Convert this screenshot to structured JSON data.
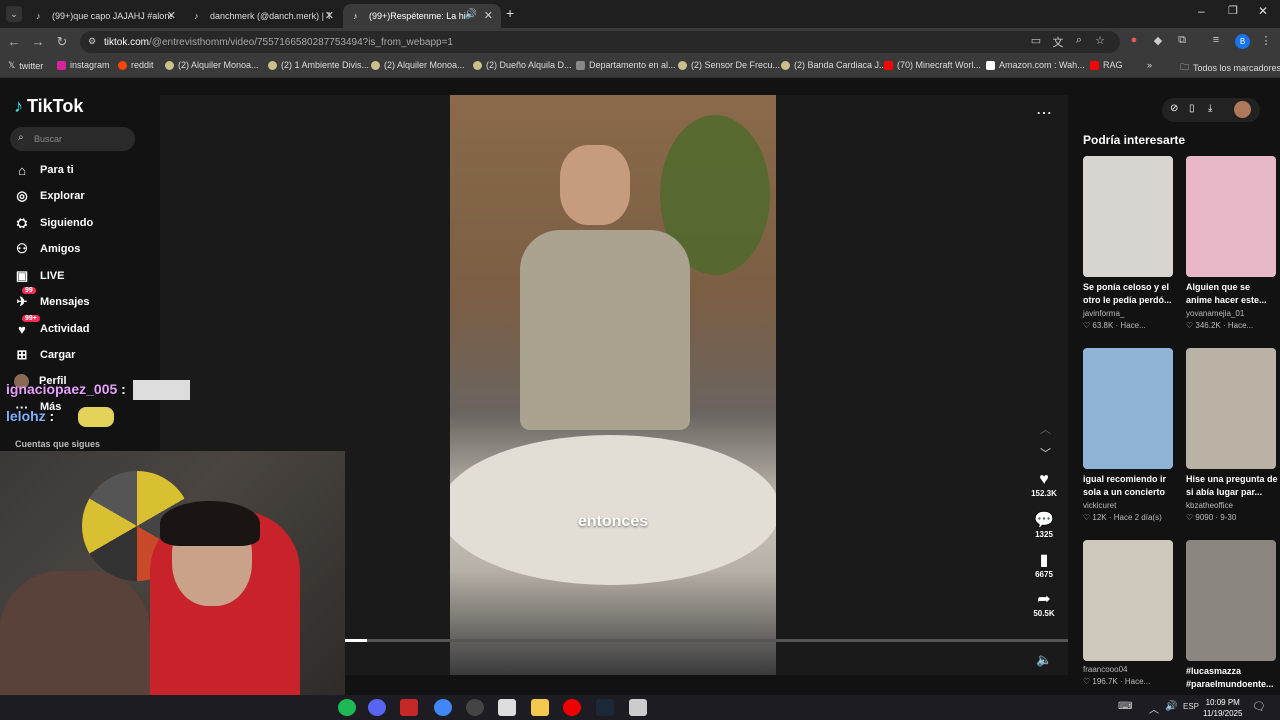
{
  "browser": {
    "tabs": [
      {
        "title": "(99+)que capo JAJAHJ #alonso...",
        "active": false
      },
      {
        "title": "danchmerk (@danch.merk) | Tik...",
        "active": false
      },
      {
        "title": "(99+)Respétenme: La histo...",
        "active": true
      }
    ],
    "url_host": "tiktok.com",
    "url_path": "/@entrevisthomm/video/7557166580287753494?is_from_webapp=1",
    "profile_initial": "B"
  },
  "bookmarks": [
    {
      "label": "twitter",
      "icon": "x-icon"
    },
    {
      "label": "instagram",
      "icon": "instagram-icon"
    },
    {
      "label": "reddit",
      "icon": "reddit-icon"
    },
    {
      "label": "(2) Alquiler Monoa...",
      "icon": "marketplace-icon"
    },
    {
      "label": "(2) 1 Ambiente Divis...",
      "icon": "marketplace-icon"
    },
    {
      "label": "(2) Alquiler Monoa...",
      "icon": "marketplace-icon"
    },
    {
      "label": "(2) Dueño Alquila D...",
      "icon": "marketplace-icon"
    },
    {
      "label": "Departamento en al...",
      "icon": "image-icon"
    },
    {
      "label": "(2) Sensor De Frecu...",
      "icon": "marketplace-icon"
    },
    {
      "label": "(2) Banda Cardiaca J...",
      "icon": "marketplace-icon"
    },
    {
      "label": "(70) Minecraft Worl...",
      "icon": "youtube-icon"
    },
    {
      "label": "Amazon.com : Wah...",
      "icon": "amazon-icon"
    },
    {
      "label": "RAG",
      "icon": "youtube-icon"
    }
  ],
  "bookmarks_all": "Todos los marcadores",
  "tiktok": {
    "logo": "TikTok",
    "search_placeholder": "Buscar",
    "nav": [
      {
        "label": "Para ti",
        "icon": "home-icon"
      },
      {
        "label": "Explorar",
        "icon": "compass-icon"
      },
      {
        "label": "Siguiendo",
        "icon": "following-icon"
      },
      {
        "label": "Amigos",
        "icon": "friends-icon"
      },
      {
        "label": "LIVE",
        "icon": "live-icon"
      },
      {
        "label": "Mensajes",
        "icon": "message-icon",
        "badge": "99"
      },
      {
        "label": "Actividad",
        "icon": "activity-icon",
        "badge": "99+"
      },
      {
        "label": "Cargar",
        "icon": "upload-icon"
      },
      {
        "label": "Perfil",
        "icon": "avatar-icon"
      },
      {
        "label": "Más",
        "icon": "more-icon"
      }
    ],
    "following_title": "Cuentas que sigues",
    "caption": "entonces",
    "likes": "152.3K",
    "comments": "1325",
    "saves": "6675",
    "shares": "50.5K",
    "progress_fraction": 0.03
  },
  "recommendations": {
    "title": "Podría interesarte",
    "items": [
      {
        "title": "Se ponía celoso y el otro le pedía perdó...",
        "user": "javinforma_",
        "stats": "♡ 63.8K · Hace...",
        "color": "#d8d4cf"
      },
      {
        "title": "Alguien que se anime hacer este...",
        "user": "yovanamejia_01",
        "stats": "♡ 346.2K · Hace...",
        "color": "#e9b8c8"
      },
      {
        "title": "igual recomiendo ir sola a un concierto",
        "user": "vickicuret",
        "stats": "♡ 12K · Hace 2 día(s)",
        "color": "#8fb4d8"
      },
      {
        "title": "Hise una pregunta de si abía lugar par...",
        "user": "kbzatheoffice",
        "stats": "♡ 9090 · 9-30",
        "color": "#b9b2a5"
      },
      {
        "title": "",
        "user": "fraancooo04",
        "stats": "♡ 196.7K · Hace...",
        "color": "#cfc9bd"
      },
      {
        "title": "#lucasmazza #paraelmundoente...",
        "user": "",
        "stats": "",
        "color": "#8c8680"
      }
    ]
  },
  "overlay": {
    "chat1_user": "ignaciopaez_005",
    "chat2_user": "lelohz"
  },
  "taskbar": {
    "time": "10:09 PM",
    "date": "11/19/2025",
    "lang": "ESP"
  }
}
